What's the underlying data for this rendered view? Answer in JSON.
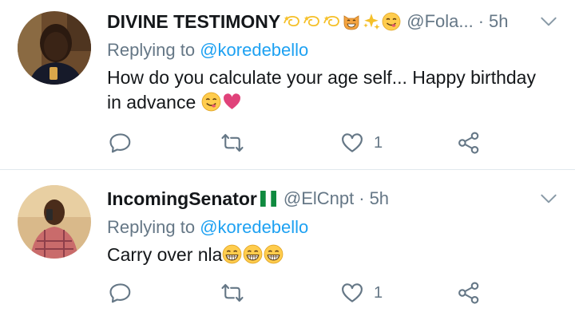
{
  "tweets": [
    {
      "display_name": "DIVINE TESTIMONY",
      "name_emojis": [
        "dizzy-emoji",
        "dizzy-emoji",
        "dizzy-emoji",
        "grinning-cat-emoji",
        "sparkles-emoji",
        "yum-emoji"
      ],
      "handle": "@Fola...",
      "separator": "·",
      "time": "5h",
      "replying_prefix": "Replying to",
      "replying_to": "@koredebello",
      "text_line1": "How do you calculate your age self... Happy birthday",
      "text_line2": "in advance",
      "text_emojis": [
        "yum-emoji",
        "heart-emoji"
      ],
      "like_count": "1"
    },
    {
      "display_name": "IncomingSenator",
      "name_emojis": [
        "nigeria-flag-emoji"
      ],
      "handle": "@ElCnpt",
      "separator": "·",
      "time": "5h",
      "replying_prefix": "Replying to",
      "replying_to": "@koredebello",
      "text_line1": "Carry over nla",
      "text_emojis": [
        "grin-emoji",
        "grin-emoji",
        "grin-emoji"
      ],
      "like_count": "1"
    }
  ],
  "colors": {
    "text_primary": "#14171a",
    "text_secondary": "#657786",
    "link": "#1da1f2",
    "divider": "#e1e8ed",
    "icon": "#657786"
  }
}
